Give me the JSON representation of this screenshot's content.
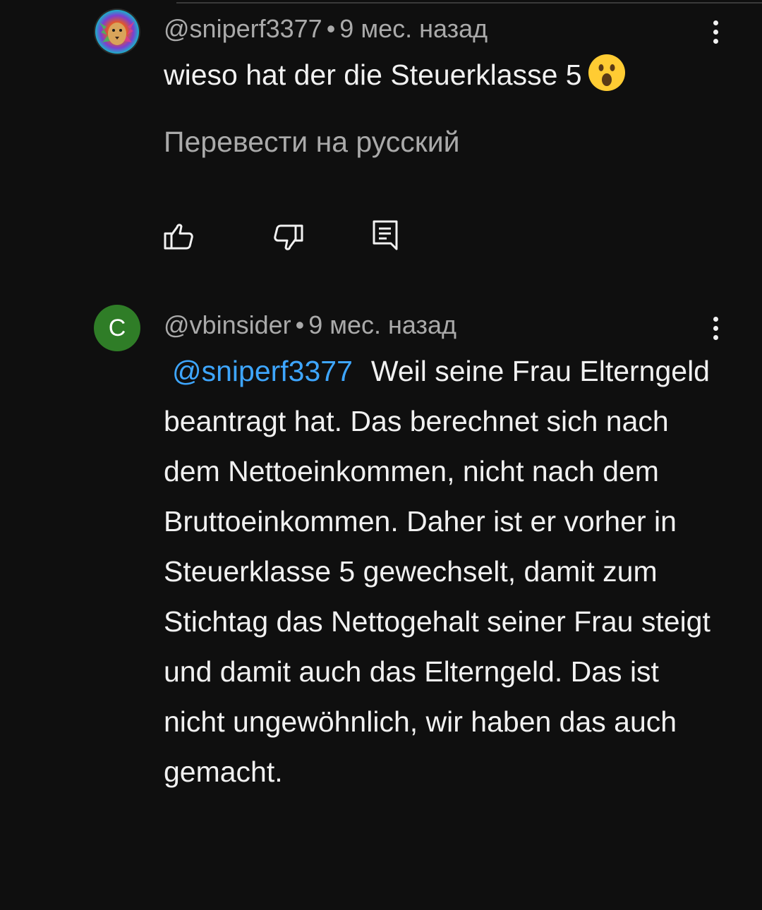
{
  "comments": [
    {
      "author": "@sniperf3377",
      "separator": "•",
      "time": "9 мес. назад",
      "text": "wieso hat der die Steuerklasse 5",
      "emoji": "😮",
      "translate_label": "Перевести на русский"
    },
    {
      "author": "@vbinsider",
      "avatar_letter": "C",
      "avatar_color": "#2f7d27",
      "separator": "•",
      "time": "9 мес. назад",
      "mention": "@sniperf3377",
      "text": "Weil seine Frau Elterngeld beantragt hat. Das berechnet sich nach dem Nettoeinkommen, nicht nach dem Bruttoeinkommen. Daher ist er vorher in Steuerklasse 5 gewechselt, damit zum Stichtag das Nettogehalt seiner Frau steigt und damit auch das Elterngeld. Das ist nicht ungewöhnlich, wir haben das auch gemacht."
    }
  ],
  "icons": {
    "like": "thumbs-up-icon",
    "dislike": "thumbs-down-icon",
    "reply": "reply-icon",
    "more": "more-vertical-icon"
  },
  "colors": {
    "background": "#0f0f0f",
    "text": "#f1f1f1",
    "secondary": "#aaaaaa",
    "mention": "#3ea6ff"
  }
}
